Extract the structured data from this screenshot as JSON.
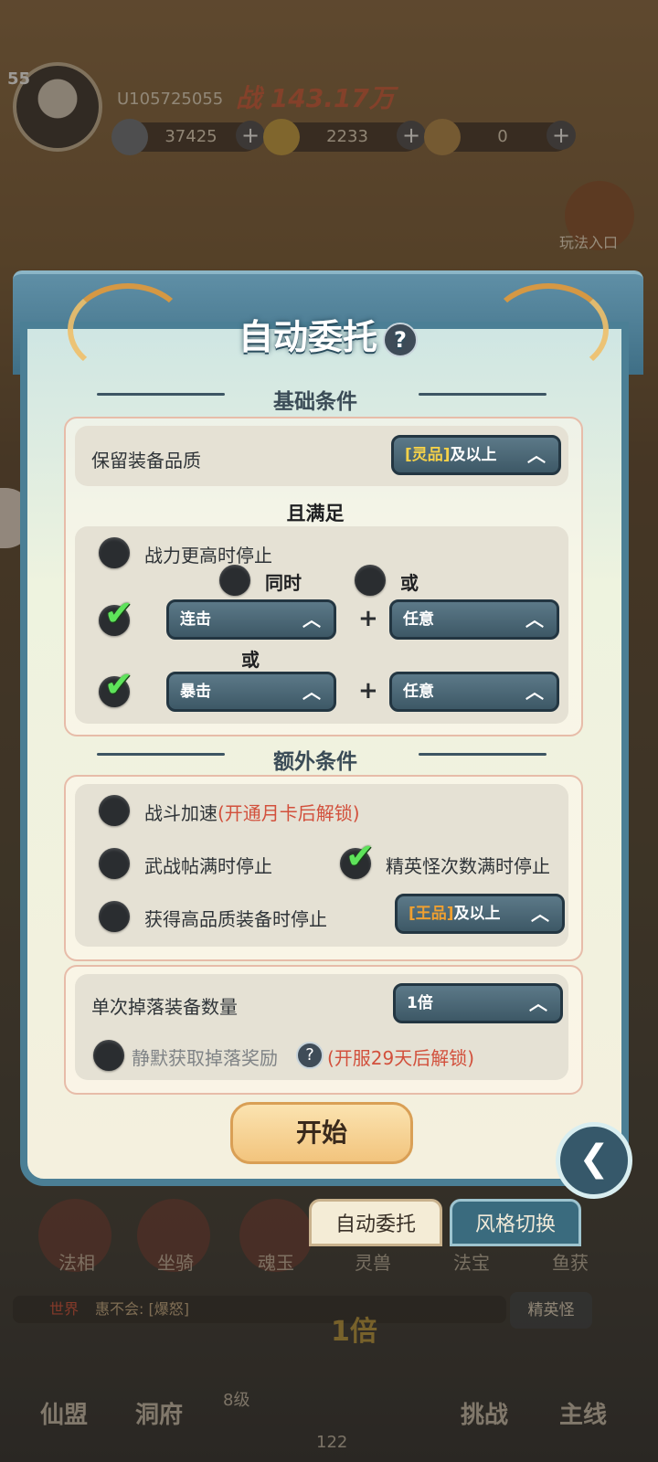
{
  "hud": {
    "level": "55",
    "uid": "U105725055",
    "power": "战 143.17万",
    "resources": [
      {
        "icon": "coin-icon",
        "value": "37425"
      },
      {
        "icon": "gold-ingot-icon",
        "value": "2233"
      },
      {
        "icon": "gem-icon",
        "value": "0"
      }
    ],
    "play_entry": "玩法入口"
  },
  "dialog": {
    "title": "自动委托",
    "help": "?",
    "basic_header": "基础条件",
    "keep_quality_label": "保留装备品质",
    "keep_quality_tag": "[灵品]",
    "keep_quality_suffix": "及以上",
    "and_satisfy": "且满足",
    "stop_higher_power": "战力更高时停止",
    "simultaneous": "同时",
    "or_option": "或",
    "combo_dd": "连击",
    "any1_dd": "任意",
    "or_mid": "或",
    "crit_dd": "暴击",
    "any2_dd": "任意",
    "plus": "+",
    "extra_header": "额外条件",
    "battle_speed": "战斗加速",
    "battle_speed_lock": "(开通月卡后解锁)",
    "war_post_stop": "武战帖满时停止",
    "elite_stop": "精英怪次数满时停止",
    "hq_equip_stop": "获得高品质装备时停止",
    "hq_tag": "[王品]",
    "hq_suffix": "及以上",
    "drop_count_label": "单次掉落装备数量",
    "drop_count_value": "1倍",
    "silent_label": "静默获取掉落奖励",
    "silent_lock": "(开服29天后解锁)",
    "start": "开始",
    "arrow_up": "︿"
  },
  "bottom": {
    "auto_tab": "自动委托",
    "style_tab": "风格切换",
    "icons": [
      "法相",
      "坐骑",
      "魂玉",
      "灵兽",
      "法宝",
      "鱼获"
    ],
    "chat_channel": "世界",
    "chat_msg": "惠不会: [爆怒]",
    "elite": "精英怪",
    "multiplier": "1倍",
    "nav": [
      "仙盟",
      "洞府",
      "挑战",
      "主线"
    ],
    "level_badge": "8级",
    "count": "122"
  }
}
